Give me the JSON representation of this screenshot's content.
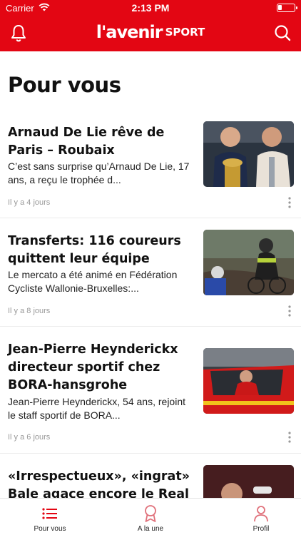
{
  "status_bar": {
    "carrier": "Carrier",
    "time": "2:13 PM",
    "battery_level": 0.25
  },
  "header": {
    "brand": "l'avenir",
    "sport": "SPORT"
  },
  "page": {
    "title": "Pour vous"
  },
  "articles": [
    {
      "title": "Arnaud De Lie rêve de Paris – Roubaix",
      "summary": "C’est sans surprise qu’Arnaud De Lie, 17 ans, a reçu le trophée d...",
      "time": "Il y a 4 jours"
    },
    {
      "title": "Transferts: 116 coureurs quittent leur équipe",
      "summary": "Le mercato a été animé en Fédération Cycliste Wallonie-Bruxelles:...",
      "time": "Il y a 8 jours"
    },
    {
      "title": "Jean-Pierre Heynderickx directeur sportif chez BORA-hansgrohe",
      "summary": "Jean-Pierre Heynderickx, 54 ans, rejoint le staff sportif de BORA...",
      "time": "Il y a 6 jours"
    },
    {
      "title": "«Irrespectueux», «ingrat» Bale agace encore le Real",
      "summary": "",
      "time": ""
    }
  ],
  "tabs": [
    {
      "label": "Pour vous"
    },
    {
      "label": "A la une"
    },
    {
      "label": "Profil"
    }
  ],
  "colors": {
    "brand_red": "#e30613",
    "muted": "#999999"
  }
}
